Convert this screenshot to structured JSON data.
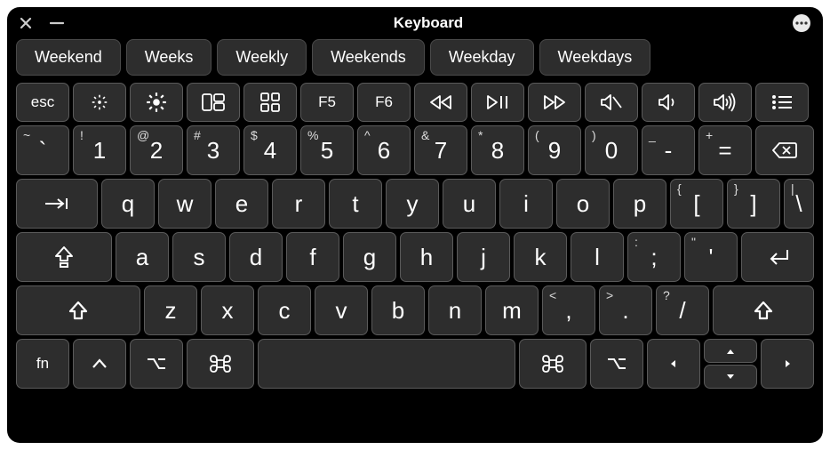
{
  "titlebar": {
    "title": "Keyboard"
  },
  "suggestions": [
    "Weekend",
    "Weeks",
    "Weekly",
    "Weekends",
    "Weekday",
    "Weekdays"
  ],
  "fn_row": {
    "esc": "esc",
    "f5": "F5",
    "f6": "F6"
  },
  "number_row": [
    {
      "main": "`",
      "shift": "~"
    },
    {
      "main": "1",
      "shift": "!"
    },
    {
      "main": "2",
      "shift": "@"
    },
    {
      "main": "3",
      "shift": "#"
    },
    {
      "main": "4",
      "shift": "$"
    },
    {
      "main": "5",
      "shift": "%"
    },
    {
      "main": "6",
      "shift": "^"
    },
    {
      "main": "7",
      "shift": "&"
    },
    {
      "main": "8",
      "shift": "*"
    },
    {
      "main": "9",
      "shift": "("
    },
    {
      "main": "0",
      "shift": ")"
    },
    {
      "main": "-",
      "shift": "_"
    },
    {
      "main": "=",
      "shift": "+"
    }
  ],
  "qwerty_row": [
    "q",
    "w",
    "e",
    "r",
    "t",
    "y",
    "u",
    "i",
    "o",
    "p"
  ],
  "bracket1": {
    "main": "[",
    "shift": "{"
  },
  "bracket2": {
    "main": "]",
    "shift": "}"
  },
  "backslash": {
    "main": "\\",
    "shift": "|"
  },
  "asdf_row": [
    "a",
    "s",
    "d",
    "f",
    "g",
    "h",
    "j",
    "k",
    "l"
  ],
  "semicolon": {
    "main": ";",
    "shift": ":"
  },
  "quote": {
    "main": "'",
    "shift": "\""
  },
  "zxcv_row": [
    "z",
    "x",
    "c",
    "v",
    "b",
    "n",
    "m"
  ],
  "comma": {
    "main": ",",
    "shift": "<"
  },
  "period": {
    "main": ".",
    "shift": ">"
  },
  "slash": {
    "main": "/",
    "shift": "?"
  },
  "bottom": {
    "fn": "fn"
  }
}
